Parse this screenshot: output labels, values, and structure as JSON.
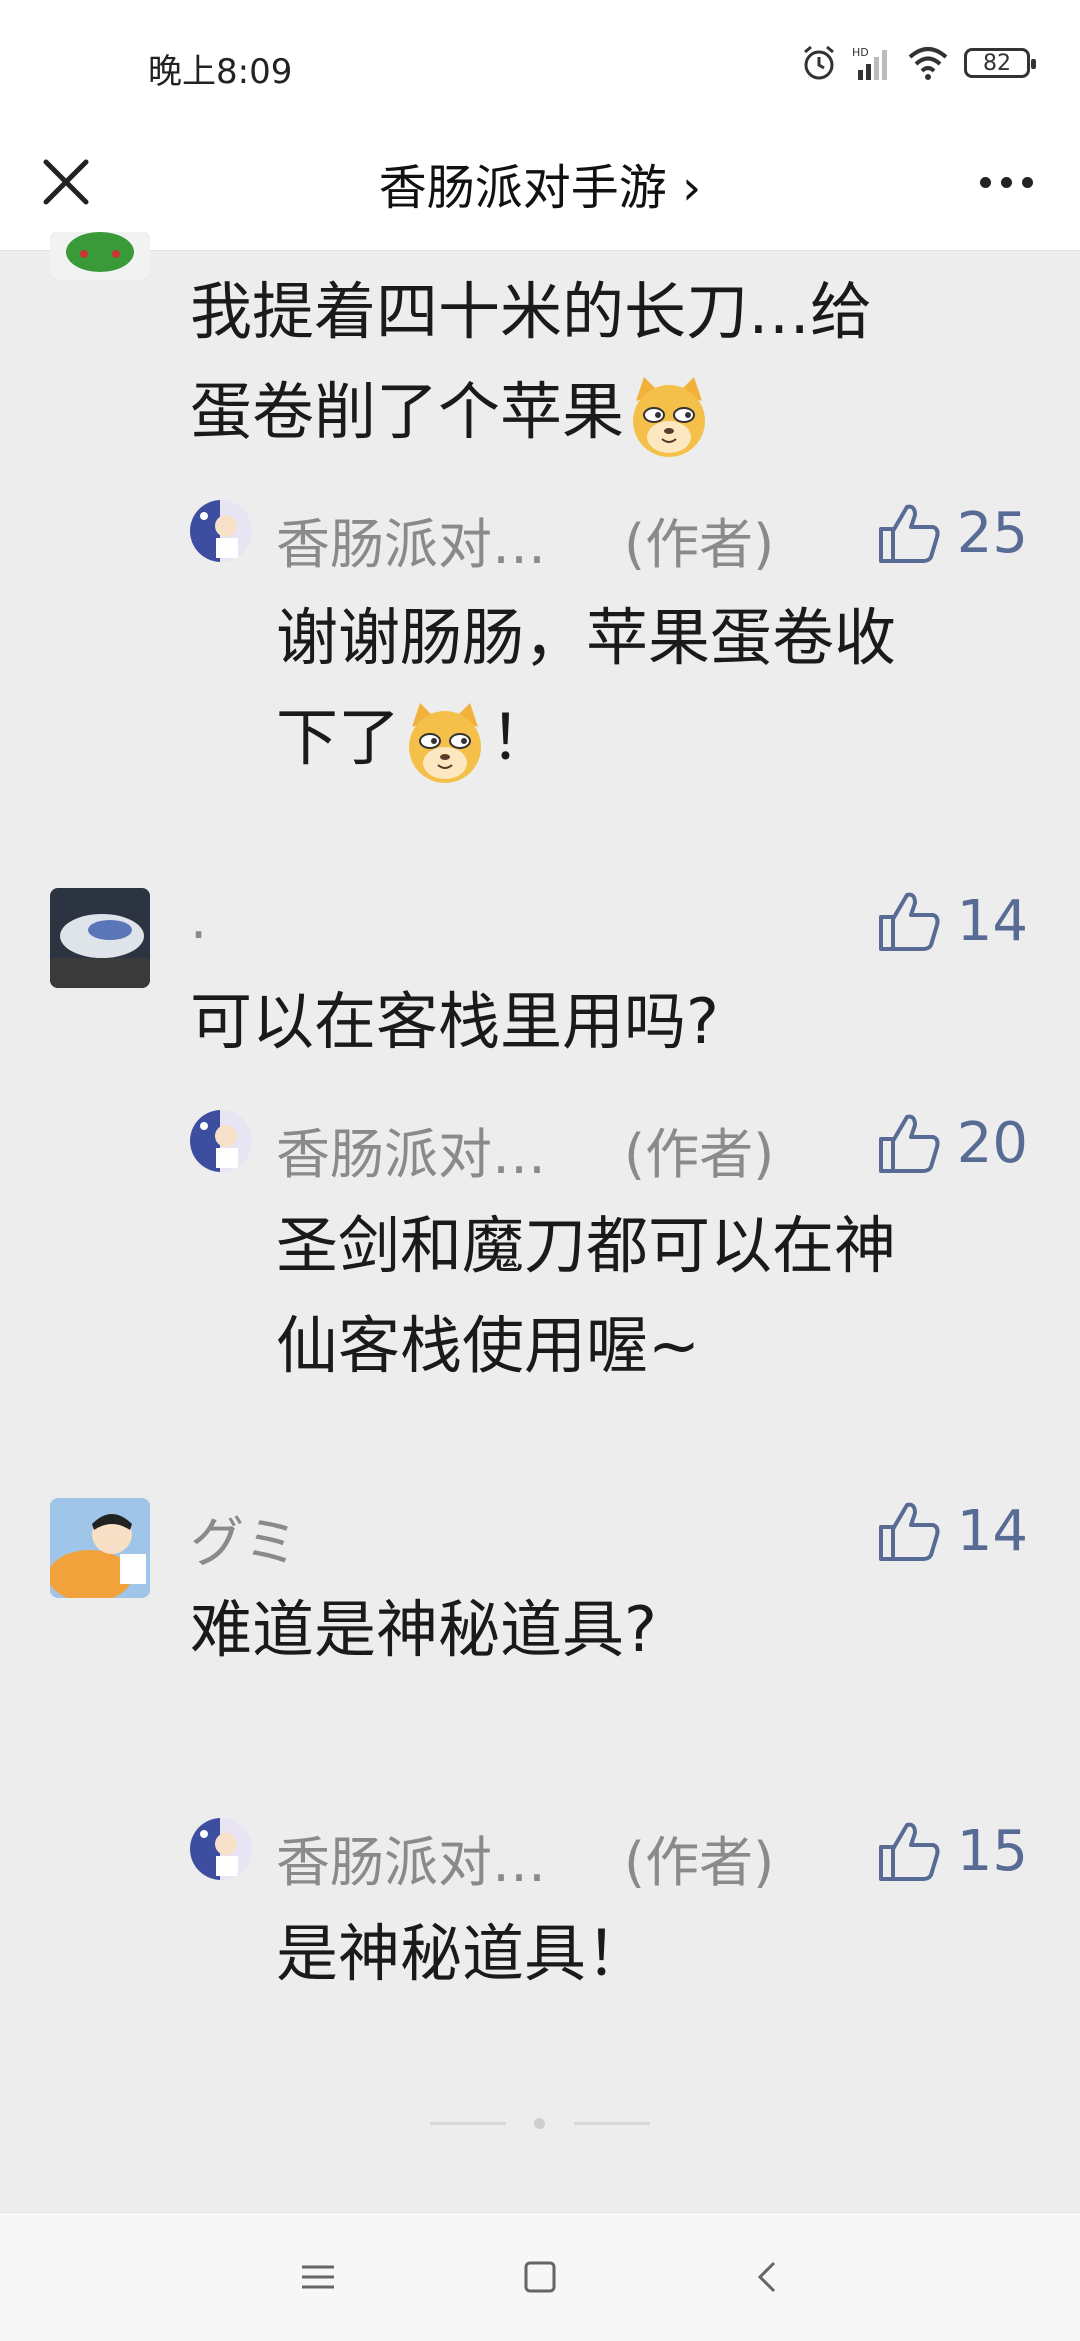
{
  "status": {
    "time": "晚上8:09",
    "battery": "82"
  },
  "header": {
    "title": "香肠派对手游 ›"
  },
  "comments": [
    {
      "text_line1": "我提着四十米的长刀…给",
      "text_line2": "蛋卷削了个苹果",
      "reply": {
        "name": "香肠派对…",
        "tag": "(作者)",
        "likes": "25",
        "line1": "谢谢肠肠，苹果蛋卷收",
        "line2": "下了",
        "line2_tail": "！"
      }
    },
    {
      "name": ".",
      "likes": "14",
      "text": "可以在客栈里用吗?",
      "reply": {
        "name": "香肠派对…",
        "tag": "(作者)",
        "likes": "20",
        "line1": "圣剑和魔刀都可以在神",
        "line2": "仙客栈使用喔~"
      }
    },
    {
      "name": "グミ",
      "likes": "14",
      "text": "难道是神秘道具?",
      "reply": {
        "name": "香肠派对…",
        "tag": "(作者)",
        "likes": "15",
        "line1": "是神秘道具！"
      }
    }
  ],
  "colors": {
    "like": "#576b95",
    "muted": "#8a8a8a",
    "background": "#ededed"
  }
}
